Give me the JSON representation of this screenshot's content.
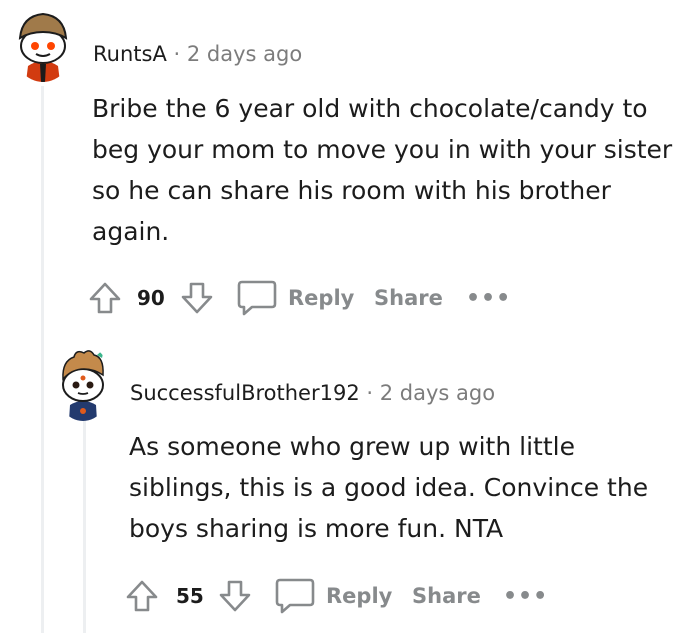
{
  "comments": [
    {
      "username": "RuntsA",
      "separator": "·",
      "timestamp": "2 days ago",
      "body": "Bribe the 6 year old with chocolate/candy to beg your mom to move you in with your sister so he can share his room with his brother again.",
      "score": "90",
      "reply_label": "Reply",
      "share_label": "Share",
      "more_label": "•••"
    },
    {
      "username": "SuccessfulBrother192",
      "separator": "·",
      "timestamp": "2 days ago",
      "body": "As someone who grew up with little siblings, this is a good idea. Convince the boys sharing is more fun. NTA",
      "score": "55",
      "reply_label": "Reply",
      "share_label": "Share",
      "more_label": "•••"
    }
  ],
  "icons": {
    "upvote": "upvote-arrow-icon",
    "downvote": "downvote-arrow-icon",
    "reply": "speech-bubble-icon"
  }
}
